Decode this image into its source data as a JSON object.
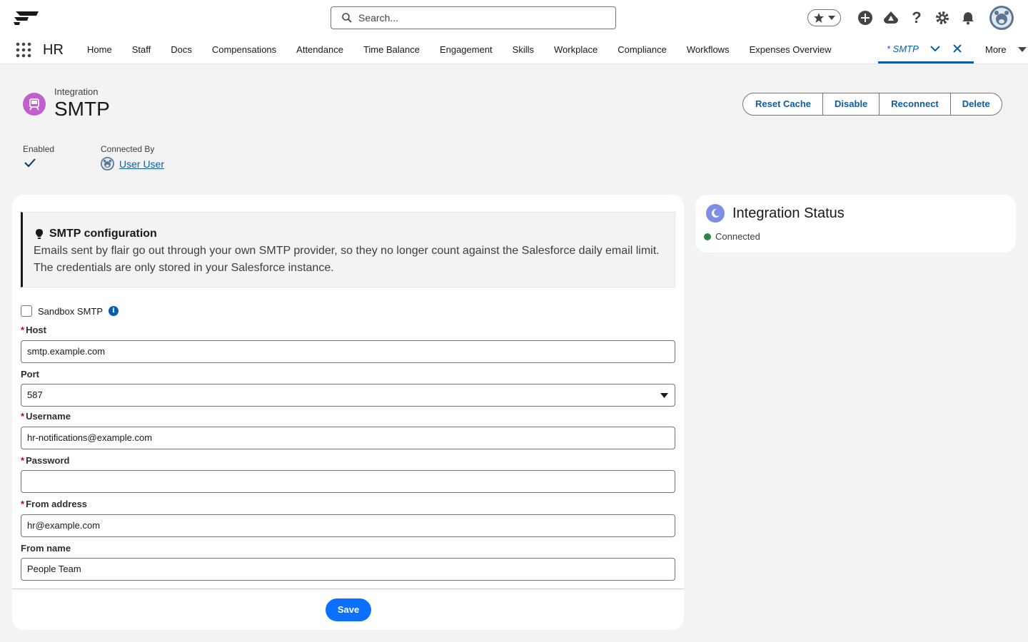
{
  "header": {
    "search_placeholder": "Search...",
    "icons": [
      "favorites-star-icon",
      "add-icon",
      "trailhead-icon",
      "help-icon",
      "setup-gear-icon",
      "notifications-bell-icon",
      "user-avatar"
    ]
  },
  "nav": {
    "app_name": "HR",
    "items": [
      "Home",
      "Staff",
      "Docs",
      "Compensations",
      "Attendance",
      "Time Balance",
      "Engagement",
      "Skills",
      "Workplace",
      "Compliance",
      "Workflows",
      "Expenses Overview"
    ],
    "active_tab": "* SMTP",
    "more_label": "More"
  },
  "page": {
    "eyebrow": "Integration",
    "title": "SMTP",
    "actions": [
      "Reset Cache",
      "Disable",
      "Reconnect",
      "Delete"
    ],
    "highlights": {
      "enabled_label": "Enabled",
      "connected_by_label": "Connected By",
      "connected_by_user": "User User"
    }
  },
  "callout": {
    "title": "SMTP configuration",
    "body": "Emails sent by flair go out through your own SMTP provider, so they no longer count against the Salesforce daily email limit. The credentials are only stored in your Salesforce instance."
  },
  "form": {
    "sandbox_label": "Sandbox SMTP",
    "sandbox_checked": false,
    "host_label": "Host",
    "host_value": "smtp.example.com",
    "port_label": "Port",
    "port_value": "587",
    "username_label": "Username",
    "username_value": "hr-notifications@example.com",
    "password_label": "Password",
    "password_value": "",
    "from_address_label": "From address",
    "from_address_value": "hr@example.com",
    "from_name_label": "From name",
    "from_name_value": "People Team",
    "save_label": "Save"
  },
  "status": {
    "title": "Integration Status",
    "state": "Connected",
    "state_color": "#2e844a"
  },
  "colors": {
    "brand_blue": "#0b5cab",
    "save_blue": "#0b70ff",
    "required_red": "#ba0517",
    "integration_icon": "#c15fcf"
  }
}
